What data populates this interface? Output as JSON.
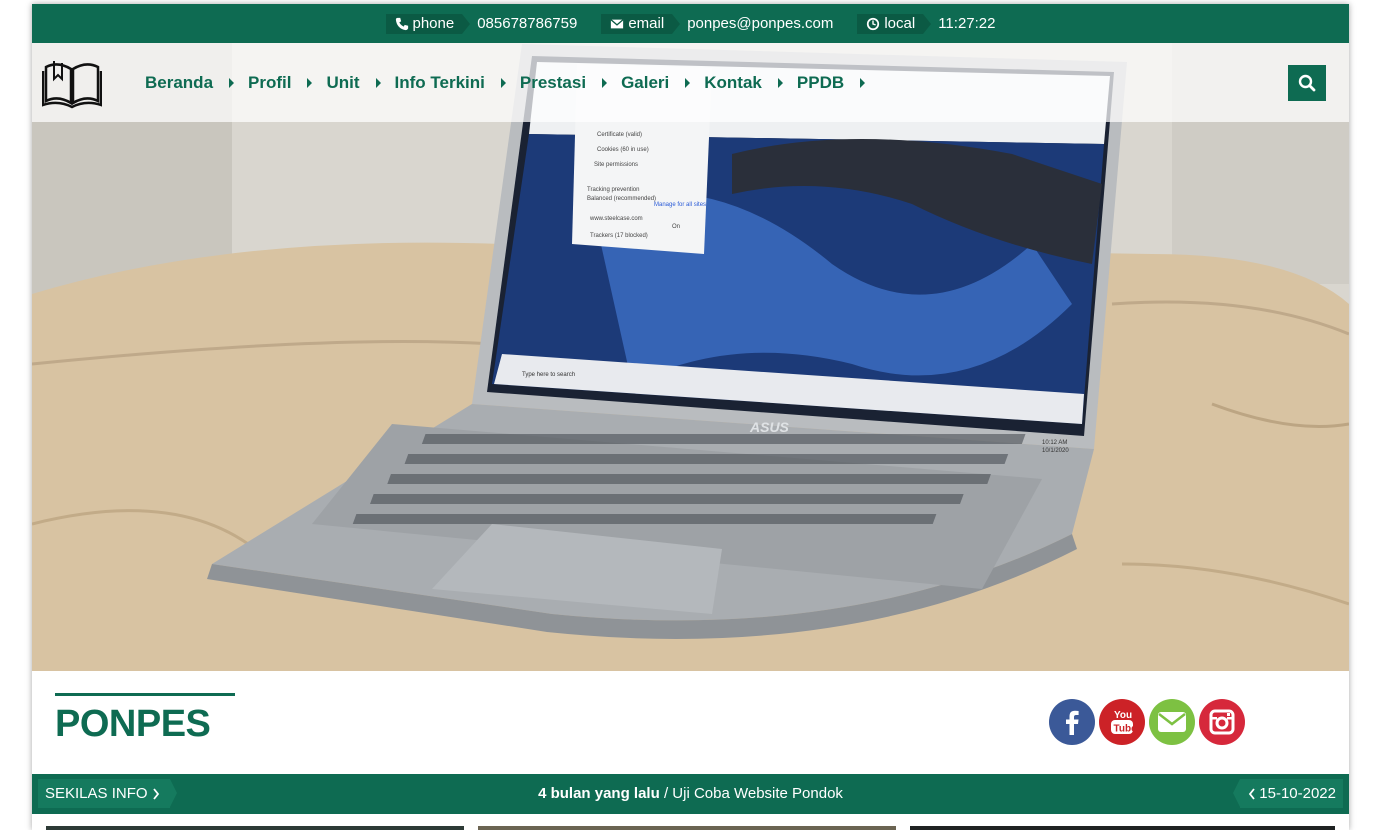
{
  "topbar": {
    "phone_label": "phone",
    "phone_value": "085678786759",
    "email_label": "email",
    "email_value": "ponpes@ponpes.com",
    "local_label": "local",
    "local_value": "11:27:22"
  },
  "nav": {
    "items": [
      {
        "label": "Beranda"
      },
      {
        "label": "Profil"
      },
      {
        "label": "Unit"
      },
      {
        "label": "Info Terkini"
      },
      {
        "label": "Prestasi"
      },
      {
        "label": "Galeri"
      },
      {
        "label": "Kontak"
      },
      {
        "label": "PPDB"
      }
    ],
    "search_icon": "search-icon"
  },
  "hero": {
    "laptop_brand": "ASUS",
    "taskbar_search": "Type here to search",
    "clock_time": "10:12 AM",
    "clock_date": "10/1/2020",
    "popup_lines": [
      "Certificate (valid)",
      "Cookies (60 in use)",
      "Site permissions",
      "Tracking prevention",
      "Balanced (recommended)",
      "Manage for all sites",
      "www.steelcase.com",
      "Trackers (17 blocked)",
      "On"
    ]
  },
  "site": {
    "title": "PONPES"
  },
  "socials": [
    {
      "name": "facebook-icon",
      "color": "#3b5998"
    },
    {
      "name": "youtube-icon",
      "color": "#cc2227"
    },
    {
      "name": "email-icon",
      "color": "#7dc142"
    },
    {
      "name": "instagram-icon",
      "color": "#d6283b"
    }
  ],
  "ticker": {
    "label": "SEKILAS INFO",
    "time_ago": "4 bulan yang lalu",
    "separator": "/",
    "headline": "Uji Coba Website Pondok",
    "date": "15-10-2022"
  },
  "colors": {
    "primary": "#0e6b52",
    "primary_dark": "#0b5a44"
  }
}
